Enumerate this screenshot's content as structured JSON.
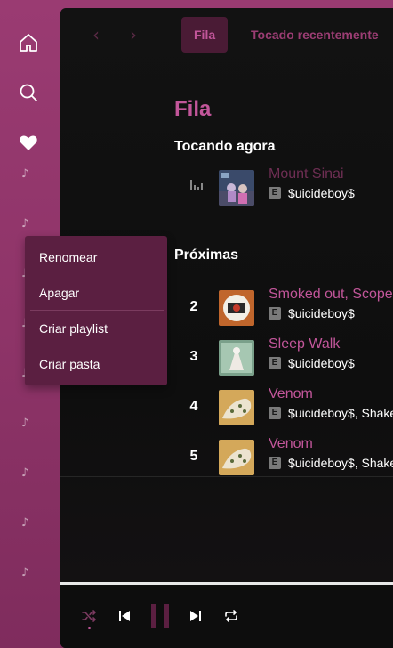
{
  "sidebar": {
    "icons": [
      "home-icon",
      "search-icon",
      "heart-icon"
    ],
    "playlist_note_glyph": "♪"
  },
  "topbar": {
    "back_glyph": "‹",
    "forward_glyph": "›",
    "tabs": [
      {
        "label": "Fila",
        "active": true
      },
      {
        "label": "Tocado recentemente",
        "active": false
      }
    ]
  },
  "queue": {
    "title": "Fila",
    "now_playing_label": "Tocando agora",
    "now_playing": {
      "title": "Mount Sinai",
      "explicit_badge": "E",
      "artist": "$uicideboy$"
    },
    "next_label": "Próximas",
    "next": [
      {
        "index": "2",
        "title": "Smoked out, Scoped",
        "explicit_badge": "E",
        "artist": "$uicideboy$"
      },
      {
        "index": "3",
        "title": "Sleep Walk",
        "explicit_badge": "E",
        "artist": "$uicideboy$"
      },
      {
        "index": "4",
        "title": "Venom",
        "explicit_badge": "E",
        "artist": "$uicideboy$, Shake"
      },
      {
        "index": "5",
        "title": "Venom",
        "explicit_badge": "E",
        "artist": "$uicideboy$, Shake"
      }
    ]
  },
  "context_menu": {
    "items": [
      "Renomear",
      "Apagar",
      "Criar playlist",
      "Criar pasta"
    ]
  },
  "player": {
    "progress_fraction": 1.0,
    "controls": [
      "shuffle-icon",
      "previous-icon",
      "pause-icon",
      "next-icon",
      "repeat-icon"
    ]
  },
  "colors": {
    "accent": "#c2569a",
    "sidebar_bg": "#8e3468",
    "menu_bg": "#5b1f41",
    "main_bg": "#121212"
  }
}
